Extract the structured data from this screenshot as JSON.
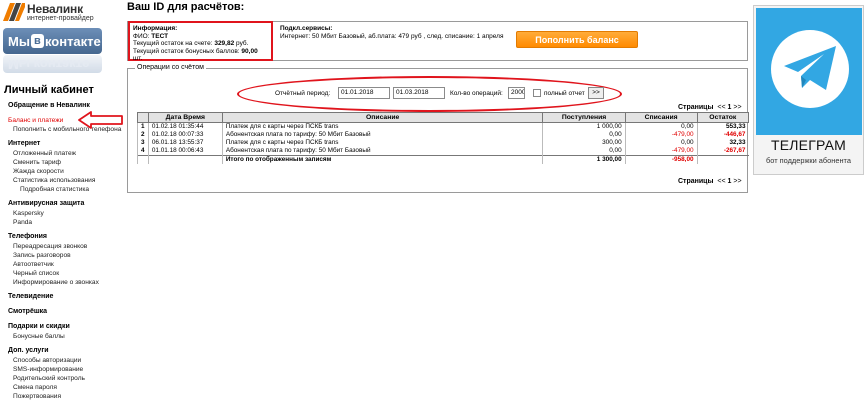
{
  "brand": {
    "name": "Невалинк",
    "tagline": "интернет-провайдер"
  },
  "social": {
    "prefix": "Мы",
    "box": "в",
    "suffix": "контакте"
  },
  "cabinet_title": "Личный кабинет",
  "menu": [
    {
      "type": "sec",
      "label": "Обращение в Невалинк"
    },
    {
      "type": "gap"
    },
    {
      "type": "item",
      "label": "Баланс и платежи",
      "active": true
    },
    {
      "type": "item",
      "label": "Пополнить с мобильного телефона"
    },
    {
      "type": "gap"
    },
    {
      "type": "sec",
      "label": "Интернет"
    },
    {
      "type": "item",
      "label": "Отложенный платеж"
    },
    {
      "type": "item",
      "label": "Сменить тариф"
    },
    {
      "type": "item",
      "label": "Жажда скорости"
    },
    {
      "type": "item",
      "label": "Статистика использования"
    },
    {
      "type": "item",
      "label": "Подробная статистика",
      "sub": true
    },
    {
      "type": "gap"
    },
    {
      "type": "sec",
      "label": "Антивирусная защита"
    },
    {
      "type": "item",
      "label": "Kaspersky"
    },
    {
      "type": "item",
      "label": "Panda"
    },
    {
      "type": "gap"
    },
    {
      "type": "sec",
      "label": "Телефония"
    },
    {
      "type": "item",
      "label": "Переадресация звонков"
    },
    {
      "type": "item",
      "label": "Запись разговоров"
    },
    {
      "type": "item",
      "label": "Автоответчик"
    },
    {
      "type": "item",
      "label": "Черный список"
    },
    {
      "type": "item",
      "label": "Информирование о звонках"
    },
    {
      "type": "gap"
    },
    {
      "type": "sec",
      "label": "Телевидение"
    },
    {
      "type": "gap"
    },
    {
      "type": "sec",
      "label": "Смотрёшка"
    },
    {
      "type": "gap"
    },
    {
      "type": "sec",
      "label": "Подарки и скидки"
    },
    {
      "type": "item",
      "label": "Бонусные баллы"
    },
    {
      "type": "gap"
    },
    {
      "type": "sec",
      "label": "Доп. услуги"
    },
    {
      "type": "item",
      "label": "Способы авторизации"
    },
    {
      "type": "item",
      "label": "SMS-информирование"
    },
    {
      "type": "item",
      "label": "Родительский контроль"
    },
    {
      "type": "item",
      "label": "Смена пароля"
    },
    {
      "type": "item",
      "label": "Пожертвования"
    }
  ],
  "header": {
    "title": "Ваш ID для расчётов:"
  },
  "info": {
    "heading": "Информация:",
    "fio_label": "ФИО:",
    "fio_value": "ТЕСТ",
    "balance_label": "Текущий остаток на счете:",
    "balance_value": "329,82",
    "balance_unit": "руб.",
    "bonus_label": "Текущий остаток бонусных баллов:",
    "bonus_value": "90,00",
    "bonus_unit": "шт."
  },
  "services": {
    "heading": "Подкл.сервисы:",
    "text": "Интернет: 50 Мбит Базовый, аб.плата: 479 руб , след. списание: 1 апреля"
  },
  "topup_button": "Пополнить баланс",
  "operations": {
    "legend": "Операции со счётом",
    "period_label": "Отчётный период:",
    "date_from": "01.01.2018",
    "date_to": "01.03.2018",
    "count_label": "Кол-во операций:",
    "count_value": "2000",
    "full_report_label": "полный отчет",
    "go_label": ">>",
    "pages_label": "Страницы",
    "pages_prev": "<<",
    "pages_current": "1",
    "pages_next": ">>",
    "columns": [
      "",
      "Дата Время",
      "Описание",
      "Поступления",
      "Списания",
      "Остаток"
    ],
    "rows": [
      {
        "n": "1",
        "date": "01.02.18 01:35:44",
        "desc": "Платеж для с карты через ПСКБ trans",
        "in": "1 000,00",
        "out": "0,00",
        "rest": "553,33",
        "out_neg": false,
        "rest_neg": false
      },
      {
        "n": "2",
        "date": "01.02.18 00:07:33",
        "desc": "Абонентская плата по тарифу: 50 Мбит Базовый",
        "in": "0,00",
        "out": "-479,00",
        "rest": "-446,67",
        "out_neg": true,
        "rest_neg": true
      },
      {
        "n": "3",
        "date": "06.01.18 13:55:37",
        "desc": "Платеж для с карты через ПСКБ trans",
        "in": "300,00",
        "out": "0,00",
        "rest": "32,33",
        "out_neg": false,
        "rest_neg": false
      },
      {
        "n": "4",
        "date": "01.01.18 00:06:43",
        "desc": "Абонентская плата по тарифу: 50 Мбит Базовый",
        "in": "0,00",
        "out": "-479,00",
        "rest": "-267,67",
        "out_neg": true,
        "rest_neg": true
      }
    ],
    "total_label": "Итого по отображенным записям",
    "total_in": "1 300,00",
    "total_out": "-958,00"
  },
  "telegram": {
    "title": "ТЕЛЕГРАМ",
    "subtitle": "бот поддержки абонента",
    "bg_color": "#32a7e3"
  },
  "colors": {
    "highlight": "#e0141c",
    "negative": "#e00000",
    "button": "#ff9500"
  }
}
